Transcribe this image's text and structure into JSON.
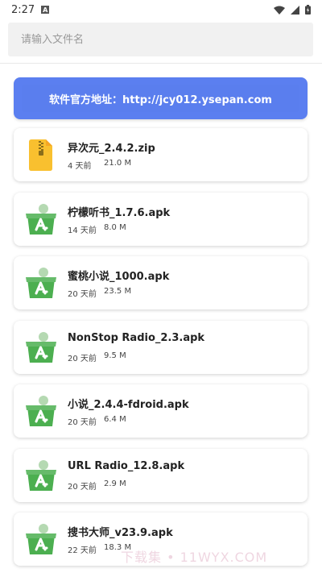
{
  "status_bar": {
    "time": "2:27",
    "notification_letter": "A"
  },
  "search": {
    "placeholder": "请输入文件名",
    "value": ""
  },
  "banner": {
    "text": "软件官方地址：http://jcy012.ysepan.com"
  },
  "files": [
    {
      "name": "异次元_2.4.2.zip",
      "date": "4 天前",
      "size": "21.0 M",
      "icon": "zip-icon"
    },
    {
      "name": "柠檬听书_1.7.6.apk",
      "date": "14 天前",
      "size": "8.0 M",
      "icon": "apk-icon"
    },
    {
      "name": "蜜桃小说_1000.apk",
      "date": "20 天前",
      "size": "23.5 M",
      "icon": "apk-icon"
    },
    {
      "name": "NonStop Radio_2.3.apk",
      "date": "20 天前",
      "size": "9.5 M",
      "icon": "apk-icon"
    },
    {
      "name": "小说_2.4.4-fdroid.apk",
      "date": "20 天前",
      "size": "6.4 M",
      "icon": "apk-icon"
    },
    {
      "name": "URL Radio_12.8.apk",
      "date": "20 天前",
      "size": "2.9 M",
      "icon": "apk-icon"
    },
    {
      "name": "搜书大师_v23.9.apk",
      "date": "22 天前",
      "size": "18.3 M",
      "icon": "apk-icon"
    }
  ],
  "watermark": "下载集 • 11WYX.COM",
  "colors": {
    "banner": "#5b7ff0",
    "apk_green": "#4caf50",
    "zip_yellow": "#f9c02f"
  }
}
